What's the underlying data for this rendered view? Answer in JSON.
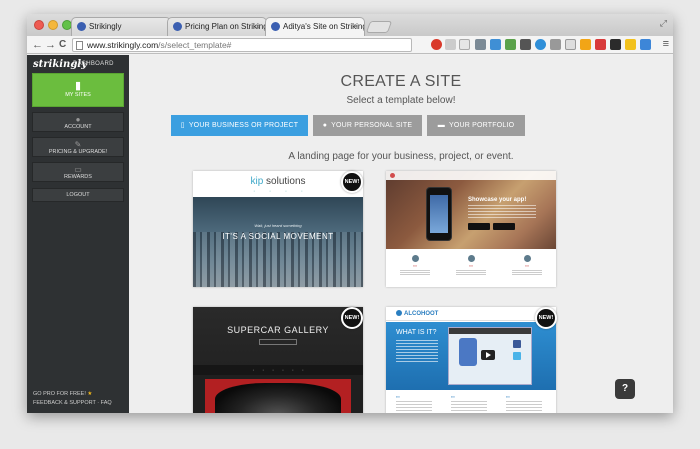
{
  "browser": {
    "tabs": [
      {
        "label": "Strikingly",
        "active": true
      },
      {
        "label": "Pricing Plan on Strikingly",
        "active": false
      },
      {
        "label": "Aditya's Site on Strikingly",
        "active": false
      }
    ],
    "tab_close": "×",
    "url_host": "www.strikingly.com",
    "url_path": "/s/select_template#",
    "nav": {
      "back": "←",
      "forward": "→",
      "reload": "C"
    },
    "menu_icon": "≡",
    "fullscreen_icon": "⤢"
  },
  "sidebar": {
    "logo": "strikingly",
    "dashboard": "DASHBOARD",
    "items": [
      {
        "label": "MY SITES",
        "icon": "page-icon",
        "glyph": "▮",
        "active": true
      },
      {
        "label": "ACCOUNT",
        "icon": "user-icon",
        "glyph": "●"
      },
      {
        "label": "PRICING & UPGRADE!",
        "icon": "wrench-icon",
        "glyph": "✎"
      },
      {
        "label": "REWARDS",
        "icon": "card-icon",
        "glyph": "▭"
      },
      {
        "label": "LOGOUT"
      }
    ],
    "footer": {
      "go_pro": "GO PRO FOR FREE!",
      "star": "★",
      "support": "FEEDBACK & SUPPORT · FAQ"
    }
  },
  "main": {
    "title": "CREATE A SITE",
    "subtitle": "Select a template below!",
    "categories": [
      {
        "label": "YOUR BUSINESS OR PROJECT",
        "icon": "page-icon",
        "glyph": "▯",
        "active": true
      },
      {
        "label": "YOUR PERSONAL SITE",
        "icon": "user-icon",
        "glyph": "●",
        "active": false
      },
      {
        "label": "YOUR PORTFOLIO",
        "icon": "briefcase-icon",
        "glyph": "▬",
        "active": false
      }
    ],
    "description": "A landing page for your business, project, or event.",
    "new_badge": "NEW!",
    "templates": {
      "kip": {
        "logo_kip": "kip",
        "logo_rest": " solutions",
        "tagline": "Wait, just heard something",
        "headline": "IT'S A SOCIAL MOVEMENT"
      },
      "app": {
        "headline": "Showcase your app!"
      },
      "supercar": {
        "title": "SUPERCAR GALLERY"
      },
      "alcohoot": {
        "logo": "ALCOHOOT",
        "headline": "WHAT IS IT?"
      }
    }
  },
  "help_button": "?",
  "colors": {
    "accent_green": "#6bbd3e",
    "accent_blue": "#3b9fe0",
    "sidebar_bg": "#2e3133"
  }
}
